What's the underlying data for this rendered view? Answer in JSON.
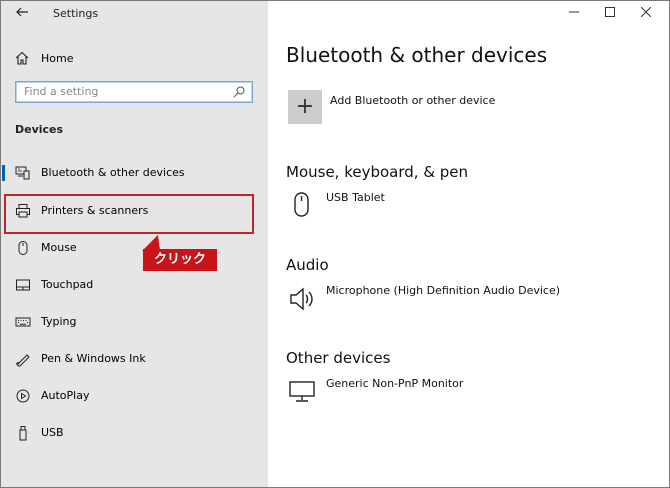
{
  "window": {
    "title": "Settings",
    "controls": {
      "minimize": "—",
      "maximize": "☐",
      "close": "✕"
    }
  },
  "sidebar": {
    "home_label": "Home",
    "search": {
      "placeholder": "Find a setting",
      "value": ""
    },
    "section_label": "Devices",
    "items": [
      {
        "label": "Bluetooth & other devices",
        "icon": "bluetooth-devices-icon",
        "selected": true
      },
      {
        "label": "Printers & scanners",
        "icon": "printer-icon",
        "selected": false
      },
      {
        "label": "Mouse",
        "icon": "mouse-icon",
        "selected": false
      },
      {
        "label": "Touchpad",
        "icon": "touchpad-icon",
        "selected": false
      },
      {
        "label": "Typing",
        "icon": "keyboard-icon",
        "selected": false
      },
      {
        "label": "Pen & Windows Ink",
        "icon": "pen-icon",
        "selected": false
      },
      {
        "label": "AutoPlay",
        "icon": "autoplay-icon",
        "selected": false
      },
      {
        "label": "USB",
        "icon": "usb-icon",
        "selected": false
      }
    ]
  },
  "annotation": {
    "callout_text": "クリック",
    "color": "#c8141a"
  },
  "main": {
    "title": "Bluetooth & other devices",
    "add_label": "Add Bluetooth or other device",
    "groups": [
      {
        "title": "Mouse, keyboard, & pen",
        "devices": [
          {
            "name": "USB Tablet",
            "icon": "mouse-icon"
          }
        ]
      },
      {
        "title": "Audio",
        "devices": [
          {
            "name": "Microphone (High Definition Audio Device)",
            "icon": "speaker-icon"
          }
        ]
      },
      {
        "title": "Other devices",
        "devices": [
          {
            "name": "Generic Non-PnP Monitor",
            "icon": "monitor-icon"
          }
        ]
      }
    ]
  },
  "colors": {
    "sidebar_bg": "#e6e6e6",
    "accent": "#0063b1",
    "highlight": "#c0262d"
  }
}
